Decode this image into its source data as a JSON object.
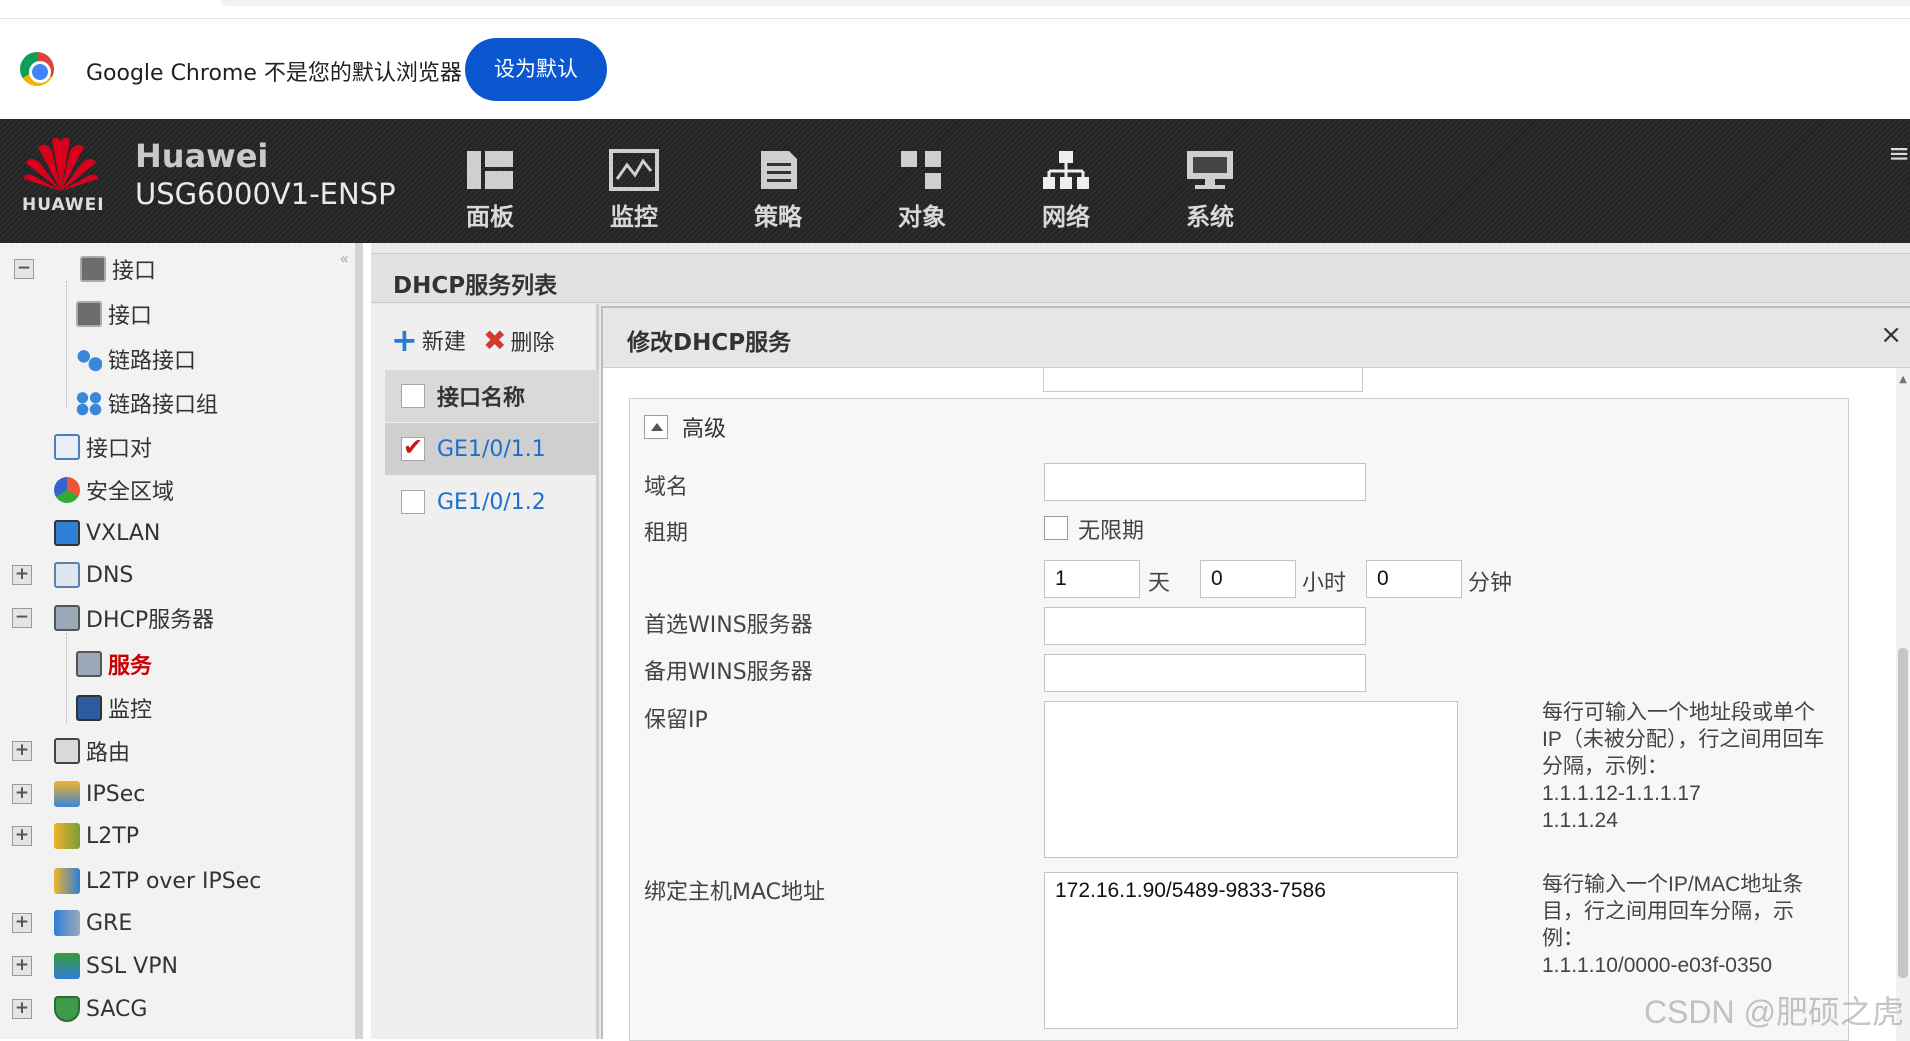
{
  "infobar": {
    "message": "Google Chrome 不是您的默认浏览器",
    "set_default_label": "设为默认"
  },
  "header": {
    "brand_text": "HUAWEI",
    "vendor": "Huawei",
    "model": "USG6000V1-ENSP",
    "nav": [
      {
        "label": "面板",
        "icon": "dashboard-icon"
      },
      {
        "label": "监控",
        "icon": "monitor-icon"
      },
      {
        "label": "策略",
        "icon": "policy-icon"
      },
      {
        "label": "对象",
        "icon": "object-icon"
      },
      {
        "label": "网络",
        "icon": "network-icon"
      },
      {
        "label": "系统",
        "icon": "system-icon"
      }
    ],
    "menu_glyph": "≡"
  },
  "sidebar": {
    "items": [
      {
        "label": "接口",
        "expander": "−"
      },
      {
        "label": "接口"
      },
      {
        "label": "链路接口"
      },
      {
        "label": "链路接口组"
      },
      {
        "label": "接口对"
      },
      {
        "label": "安全区域"
      },
      {
        "label": "VXLAN"
      },
      {
        "label": "DNS",
        "expander": "+"
      },
      {
        "label": "DHCP服务器",
        "expander": "−"
      },
      {
        "label": "服务"
      },
      {
        "label": "监控"
      },
      {
        "label": "路由",
        "expander": "+"
      },
      {
        "label": "IPSec",
        "expander": "+"
      },
      {
        "label": "L2TP",
        "expander": "+"
      },
      {
        "label": "L2TP over IPSec"
      },
      {
        "label": "GRE",
        "expander": "+"
      },
      {
        "label": "SSL VPN",
        "expander": "+"
      },
      {
        "label": "SACG",
        "expander": "+"
      }
    ]
  },
  "main": {
    "title": "DHCP服务列表",
    "toolbar": {
      "new_label": "新建",
      "delete_label": "删除"
    },
    "table": {
      "header": "接口名称",
      "rows": [
        {
          "name": "GE1/0/1.1",
          "checked": true
        },
        {
          "name": "GE1/0/1.2",
          "checked": false
        }
      ]
    }
  },
  "modal": {
    "title": "修改DHCP服务",
    "close": "×",
    "section": "高级",
    "fields": {
      "domain_label": "域名",
      "domain_value": "",
      "lease_label": "租期",
      "unlimited_label": "无限期",
      "lease_days": "1",
      "days_unit": "天",
      "lease_hours": "0",
      "hours_unit": "小时",
      "lease_minutes": "0",
      "minutes_unit": "分钟",
      "wins_primary_label": "首选WINS服务器",
      "wins_primary_value": "",
      "wins_backup_label": "备用WINS服务器",
      "wins_backup_value": "",
      "reserved_ip_label": "保留IP",
      "reserved_ip_value": "",
      "reserved_ip_hint": "每行可输入一个地址段或单个IP（未被分配），行之间用回车分隔，示例：\n1.1.1.12-1.1.1.17\n1.1.1.24",
      "mac_bind_label": "绑定主机MAC地址",
      "mac_bind_value": "172.16.1.90/5489-9833-7586",
      "mac_bind_hint": "每行输入一个IP/MAC地址条目，行之间用回车分隔，示例：\n1.1.1.10/0000-e03f-0350"
    }
  },
  "watermark": "CSDN @肥硕之虎",
  "colors": {
    "link": "#1a6fd1",
    "active": "#cc0000",
    "accent": "#0b57d0",
    "header_bg": "#2a2a2a",
    "huawei_red": "#d8001c"
  }
}
